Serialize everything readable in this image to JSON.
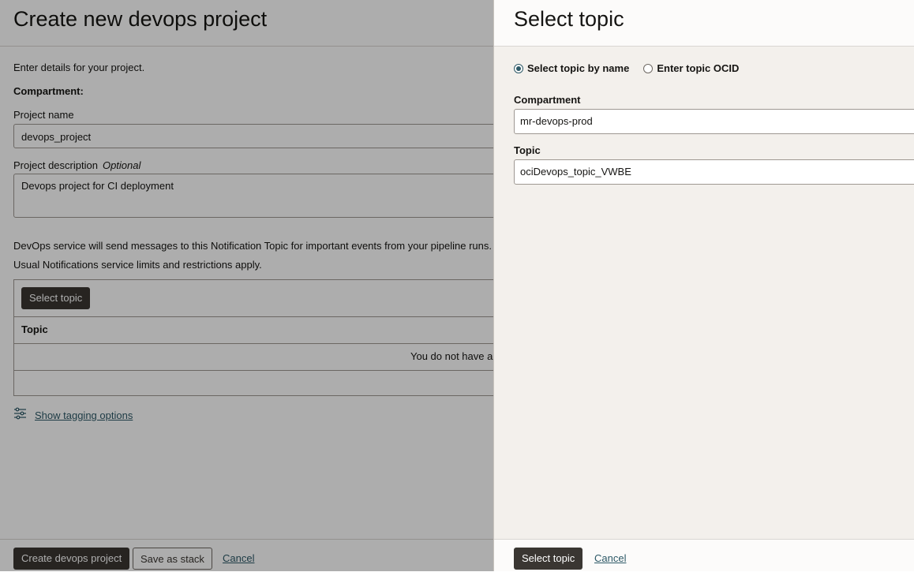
{
  "main": {
    "title": "Create new devops project",
    "intro": "Enter details for your project.",
    "compartment_label": "Compartment:",
    "project_name_label": "Project name",
    "project_name_value": "devops_project",
    "project_description_label": "Project description",
    "optional_label": "Optional",
    "project_description_value": "Devops project for CI deployment",
    "notification_info_1": "DevOps service will send messages to this Notification Topic for important events from your pipeline runs.",
    "notification_info_2": "Usual Notifications service limits and restrictions apply.",
    "select_topic_button": "Select topic",
    "table_header_topic": "Topic",
    "table_empty_message": "You do not have any items to display",
    "tagging_link": "Show tagging options"
  },
  "footer": {
    "create_button": "Create devops project",
    "save_stack_button": "Save as stack",
    "cancel_link": "Cancel"
  },
  "drawer": {
    "title": "Select topic",
    "radio_by_name": "Select topic by name",
    "radio_by_ocid": "Enter topic OCID",
    "compartment_label": "Compartment",
    "compartment_value": "mr-devops-prod",
    "topic_label": "Topic",
    "topic_value": "ociDevops_topic_VWBE",
    "select_button": "Select topic",
    "cancel_link": "Cancel"
  },
  "colors": {
    "primary_button": "#3a3632",
    "link": "#2d5967",
    "drawer_bg": "#f3f0ec"
  }
}
